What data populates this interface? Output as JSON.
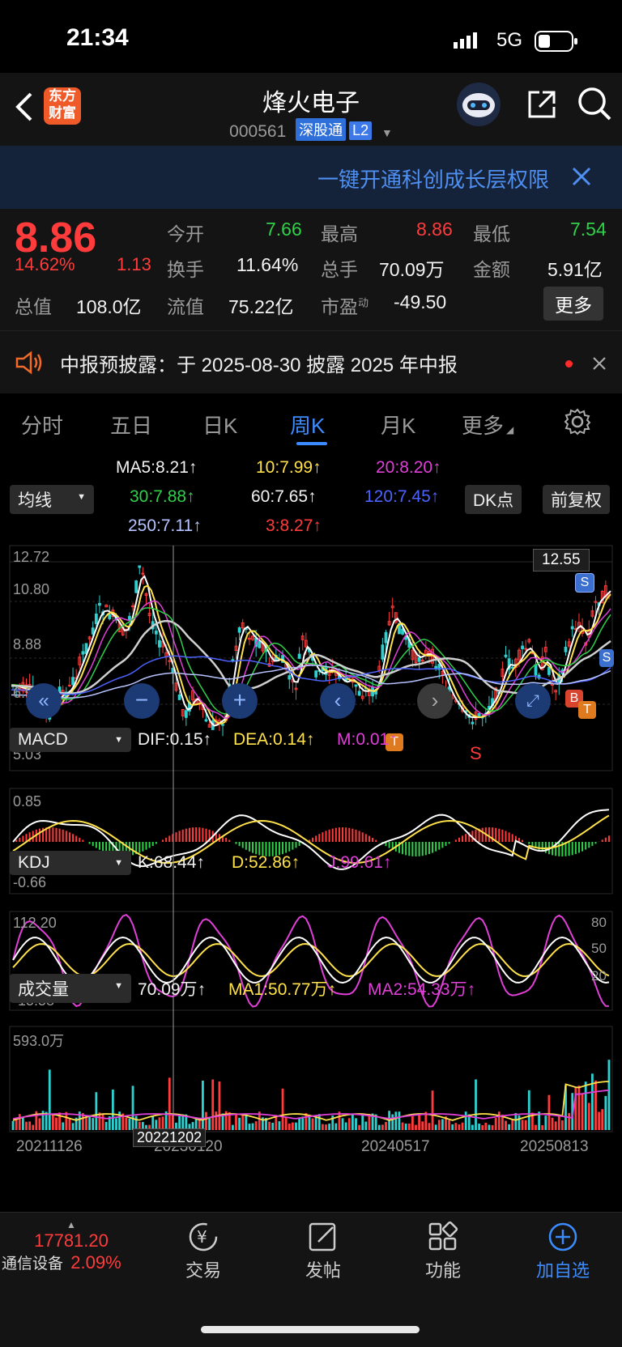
{
  "status": {
    "time": "21:34",
    "network": "5G"
  },
  "header": {
    "title": "烽火电子",
    "code": "000561",
    "tag1": "深股通",
    "tag2": "L2",
    "logo_line1": "东方",
    "logo_line2": "财富"
  },
  "banner": {
    "text": "一键开通科创成长层权限"
  },
  "quote": {
    "price": "8.86",
    "change_pct": "14.62%",
    "change": "1.13",
    "open_label": "今开",
    "open": "7.66",
    "high_label": "最高",
    "high": "8.86",
    "low_label": "最低",
    "low": "7.54",
    "turnover_label": "换手",
    "turnover": "11.64%",
    "volume_label": "总手",
    "volume": "70.09万",
    "amount_label": "金额",
    "amount": "5.91亿",
    "mktcap_label": "总值",
    "mktcap": "108.0亿",
    "float_label": "流值",
    "float": "75.22亿",
    "pe_label": "市盈",
    "pe_sup": "动",
    "pe": "-49.50",
    "more_button": "更多"
  },
  "notice": {
    "text": "中报预披露：于 2025-08-30 披露 2025 年中报"
  },
  "tabs": [
    "分时",
    "五日",
    "日K",
    "周K",
    "月K",
    "更多"
  ],
  "active_tab": "周K",
  "ma": {
    "selector": "均线",
    "ma5": "MA5:8.21",
    "ma10": "10:7.99",
    "ma20": "20:8.20",
    "ma30": "30:7.88",
    "ma60": "60:7.65",
    "ma120": "120:7.45",
    "ma250": "250:7.11",
    "ma3": "3:8.27",
    "dk_button": "DK点",
    "adjust_button": "前复权"
  },
  "kline": {
    "ymax": "12.72",
    "y2": "10.80",
    "y3": "8.88",
    "y4": "6.96",
    "ymin": "5.03",
    "cursor_price": "12.55"
  },
  "macd": {
    "selector": "MACD",
    "dif": "DIF:0.15",
    "dea": "DEA:0.14",
    "m": "M:0.01",
    "ymax": "0.85",
    "ymin": "-0.66"
  },
  "kdj": {
    "selector": "KDJ",
    "k": "K:68.44",
    "d": "D:52.86",
    "j": "J:99.61",
    "ymax": "112.20",
    "ymin": "-15.58",
    "l80": "80",
    "l50": "50",
    "l20": "20"
  },
  "vol": {
    "selector": "成交量",
    "vol": "70.09万",
    "ma1": "MA1:50.77万",
    "ma2": "MA2:54.33万",
    "ymax": "593.0万"
  },
  "dates": [
    "20211126",
    "20230120",
    "20240517",
    "20250813"
  ],
  "cursor_date": "20221202",
  "bottom": {
    "index_value": "17781.20",
    "index_name": "通信设备",
    "index_pct": "2.09%",
    "trade": "交易",
    "post": "发帖",
    "func": "功能",
    "add": "加自选"
  },
  "colors": {
    "up": "#ff3b3b",
    "down": "#2fd04a",
    "accent": "#3c78e8"
  }
}
